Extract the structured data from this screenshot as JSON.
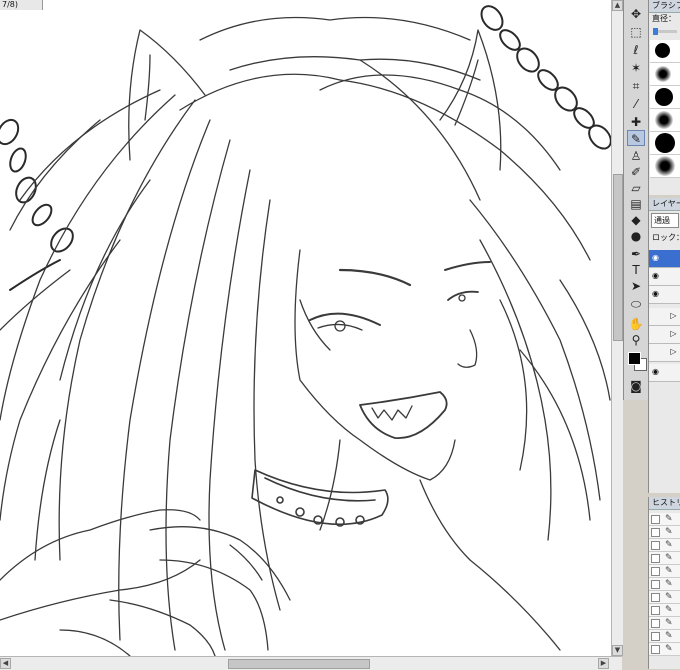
{
  "document_tab": {
    "label": "7/8)"
  },
  "toolbox": {
    "tools": [
      {
        "name": "move-tool",
        "glyph": "✥"
      },
      {
        "name": "marquee-tool",
        "glyph": "⬚"
      },
      {
        "name": "lasso-tool",
        "glyph": "ℓ"
      },
      {
        "name": "magic-wand-tool",
        "glyph": "✶"
      },
      {
        "name": "crop-tool",
        "glyph": "⌗"
      },
      {
        "name": "eyedropper-tool",
        "glyph": "⁄"
      },
      {
        "name": "healing-brush-tool",
        "glyph": "✚"
      },
      {
        "name": "brush-tool",
        "glyph": "✎"
      },
      {
        "name": "clone-stamp-tool",
        "glyph": "♙"
      },
      {
        "name": "history-brush-tool",
        "glyph": "✐"
      },
      {
        "name": "eraser-tool",
        "glyph": "▱"
      },
      {
        "name": "gradient-tool",
        "glyph": "▤"
      },
      {
        "name": "blur-tool",
        "glyph": "◆"
      },
      {
        "name": "dodge-tool",
        "glyph": "●"
      },
      {
        "name": "pen-tool",
        "glyph": "✒"
      },
      {
        "name": "type-tool",
        "glyph": "T"
      },
      {
        "name": "path-selection-tool",
        "glyph": "➤"
      },
      {
        "name": "shape-tool",
        "glyph": "⬭"
      },
      {
        "name": "hand-tool",
        "glyph": "✋"
      },
      {
        "name": "zoom-tool",
        "glyph": "⚲"
      }
    ]
  },
  "brush_panel": {
    "title": "ブラシプリセ",
    "diameter_label": "直径："
  },
  "layers_panel": {
    "title": "レイヤー",
    "blend_mode": "通過",
    "lock_label": "ロック："
  },
  "history_panel": {
    "title": "ヒストリー"
  }
}
